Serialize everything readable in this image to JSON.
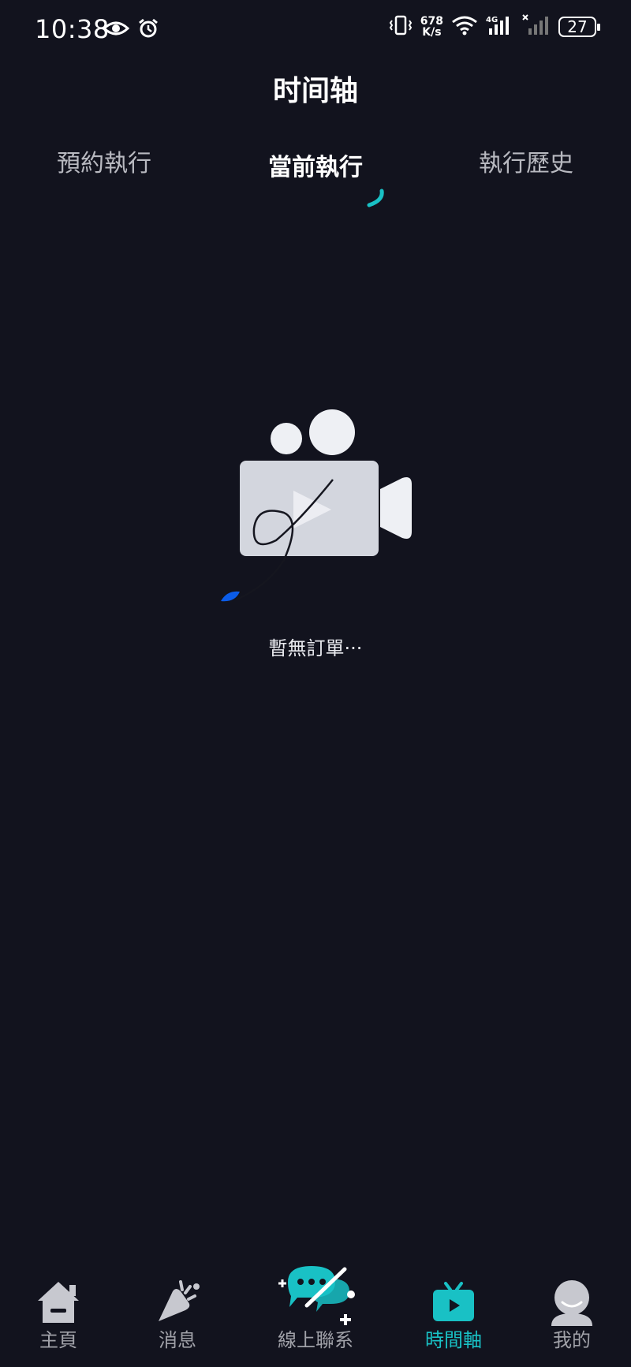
{
  "status_bar": {
    "time": "10:38",
    "net_speed_value": "678",
    "net_speed_unit": "K/s",
    "network_type": "4G",
    "battery": "27"
  },
  "header": {
    "title": "时间轴"
  },
  "tabs": [
    {
      "label": "預約執行",
      "active": false
    },
    {
      "label": "當前執行",
      "active": true
    },
    {
      "label": "執行歷史",
      "active": false
    }
  ],
  "empty_state": {
    "message": "暫無訂單···"
  },
  "bottom_nav": {
    "items": [
      {
        "label": "主頁",
        "icon": "home-icon",
        "active": false
      },
      {
        "label": "消息",
        "icon": "megaphone-icon",
        "active": false
      },
      {
        "label": "線上聯系",
        "icon": "chat-bubbles-icon",
        "active": false
      },
      {
        "label": "時間軸",
        "icon": "tv-play-icon",
        "active": true
      },
      {
        "label": "我的",
        "icon": "user-avatar-icon",
        "active": false
      }
    ]
  },
  "colors": {
    "background": "#12131e",
    "accent": "#19c1c5",
    "inactive_text": "#a0a1a8",
    "illustration_gray": "#d3d6de",
    "spinner_blue": "#0b5ce8"
  }
}
